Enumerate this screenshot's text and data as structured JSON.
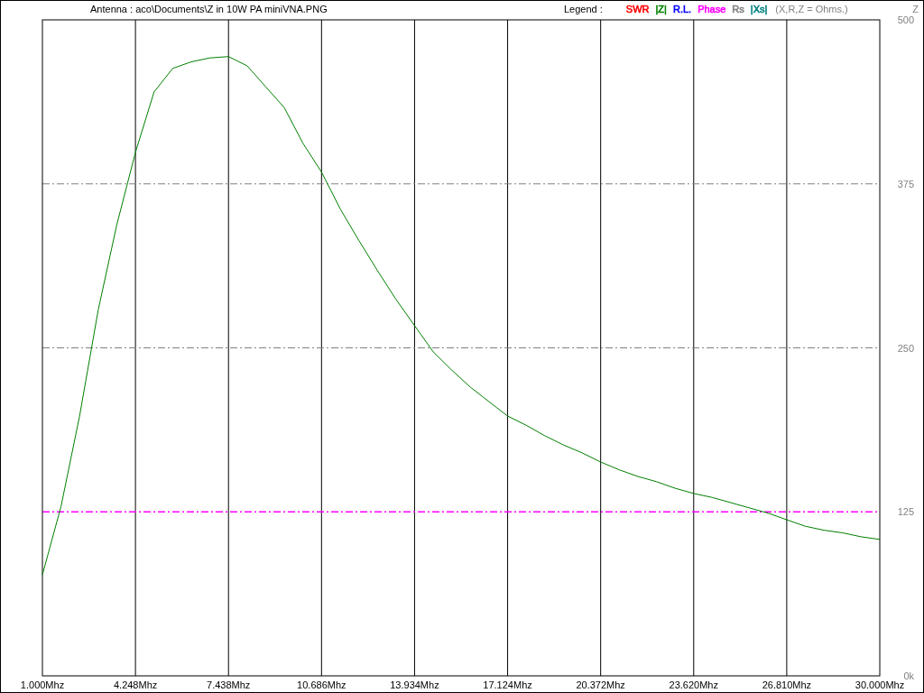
{
  "header": {
    "title": "Antenna : aco\\Documents\\Z in 10W PA miniVNA.PNG"
  },
  "legend": {
    "label": "Legend :",
    "items": [
      {
        "label": "SWR",
        "color": "#ff0000"
      },
      {
        "label": "|Z|",
        "color": "#008000"
      },
      {
        "label": "R.L.",
        "color": "#0000ff"
      },
      {
        "label": "Phase",
        "color": "#ff00ff"
      },
      {
        "label": "Rs",
        "color": "#808080"
      },
      {
        "label": "|Xs|",
        "color": "#008080"
      }
    ],
    "units_note": "(X,R,Z = Ohms.)"
  },
  "chart": {
    "chart_data": {
      "type": "line",
      "grid": true,
      "ylabel": "Z",
      "ylim": [
        0,
        500
      ],
      "categories": [
        "1.000Mhz",
        null,
        null,
        null,
        null,
        "4.248Mhz",
        null,
        null,
        null,
        null,
        "7.438Mhz",
        null,
        null,
        null,
        null,
        "10.686Mhz",
        null,
        null,
        null,
        null,
        "13.934Mhz",
        null,
        null,
        null,
        null,
        "17.124Mhz",
        null,
        null,
        null,
        null,
        "20.372Mhz",
        null,
        null,
        null,
        null,
        "23.620Mhz",
        null,
        null,
        null,
        null,
        "26.810Mhz",
        null,
        null,
        null,
        null,
        "30.000Mhz"
      ],
      "yticks": [
        {
          "value": 0,
          "label": "0k"
        },
        125,
        250,
        375,
        500
      ],
      "series": [
        {
          "color": "#008000",
          "values": [
            77,
            129,
            198,
            279,
            344,
            399,
            445,
            463,
            468,
            471,
            472,
            465,
            449,
            433,
            406,
            384,
            356,
            332,
            309,
            287,
            267,
            247,
            233,
            220,
            209,
            198,
            191,
            183,
            176,
            170,
            163,
            157,
            152,
            148,
            143,
            139,
            136,
            132,
            128,
            124,
            119,
            114,
            111,
            109,
            106,
            104
          ]
        }
      ],
      "ref_lines": [
        {
          "axis": "y",
          "value": 125,
          "color": "#ff00ff"
        }
      ]
    }
  }
}
